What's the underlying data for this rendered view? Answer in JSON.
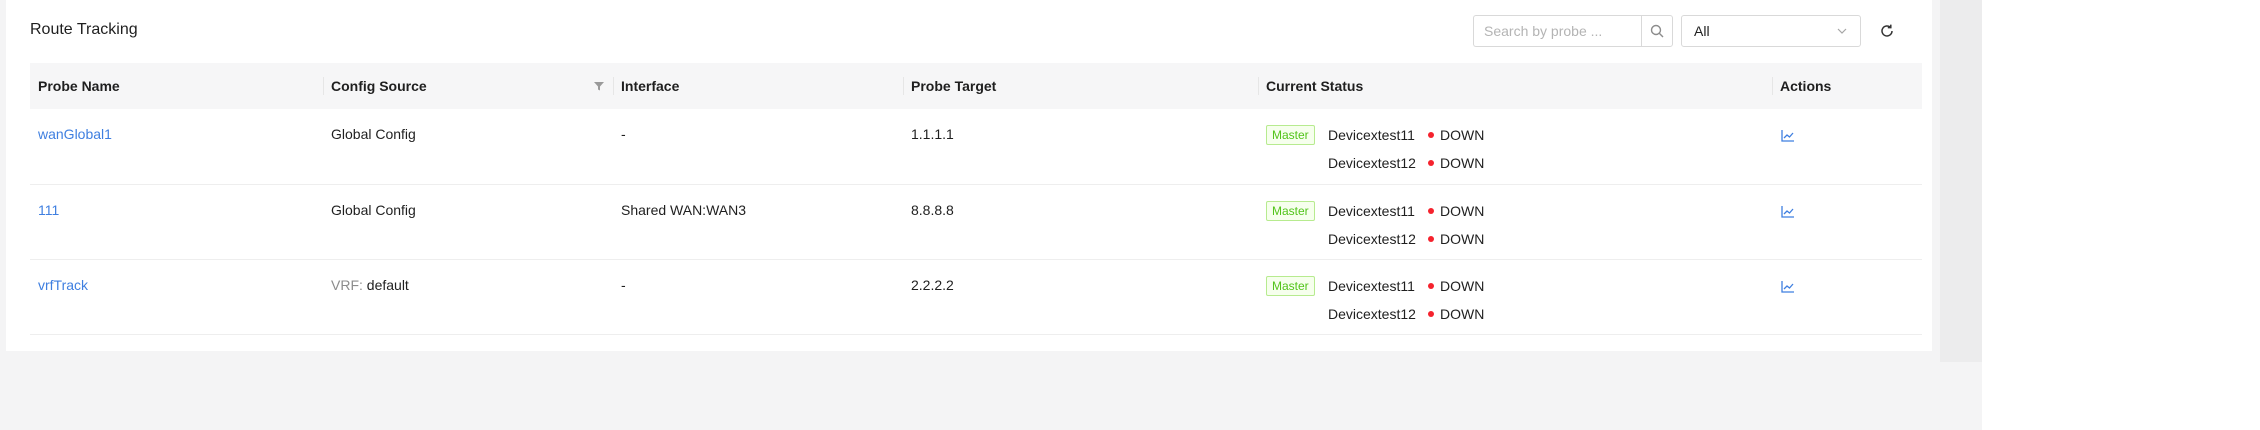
{
  "page": {
    "title": "Route Tracking"
  },
  "toolbar": {
    "search_placeholder": "Search by probe ...",
    "search_icon": "search-icon",
    "filter_value": "All",
    "filter_icon": "chevron-down-icon",
    "refresh_icon": "refresh-icon"
  },
  "table": {
    "columns": [
      "Probe Name",
      "Config Source",
      "Interface",
      "Probe Target",
      "Current Status",
      "Actions"
    ],
    "config_source_filter_icon": "filter-icon",
    "rows": [
      {
        "probe_name": "wanGlobal1",
        "config_prefix": "",
        "config_source": "Global Config",
        "interface": "-",
        "probe_target": "1.1.1.1",
        "master_badge": "Master",
        "statuses": [
          {
            "device": "Devicextest11",
            "state": "DOWN"
          },
          {
            "device": "Devicextest12",
            "state": "DOWN"
          }
        ],
        "action_icon": "line-chart-icon"
      },
      {
        "probe_name": "111",
        "config_prefix": "",
        "config_source": "Global Config",
        "interface": "Shared WAN:WAN3",
        "probe_target": "8.8.8.8",
        "master_badge": "Master",
        "statuses": [
          {
            "device": "Devicextest11",
            "state": "DOWN"
          },
          {
            "device": "Devicextest12",
            "state": "DOWN"
          }
        ],
        "action_icon": "line-chart-icon"
      },
      {
        "probe_name": "vrfTrack",
        "config_prefix": "VRF:",
        "config_source": "default",
        "interface": "-",
        "probe_target": "2.2.2.2",
        "master_badge": "Master",
        "statuses": [
          {
            "device": "Devicextest11",
            "state": "DOWN"
          },
          {
            "device": "Devicextest12",
            "state": "DOWN"
          }
        ],
        "action_icon": "line-chart-icon"
      }
    ]
  },
  "colors": {
    "link": "#3f7fe0",
    "status_down": "#f5222d",
    "badge_green": "#52c41a"
  }
}
